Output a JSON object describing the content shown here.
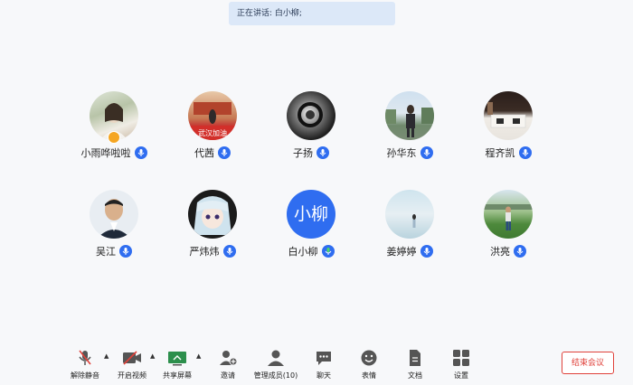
{
  "speaking_label": "正在讲话: 白小柳;",
  "participants": [
    {
      "name": "小雨哗啦啦",
      "kind": "photo",
      "host": true
    },
    {
      "name": "代茜",
      "kind": "photo",
      "host": false
    },
    {
      "name": "子扬",
      "kind": "photo",
      "host": false
    },
    {
      "name": "孙华东",
      "kind": "photo",
      "host": false
    },
    {
      "name": "程齐凯",
      "kind": "photo",
      "host": false
    },
    {
      "name": "吴江",
      "kind": "photo",
      "host": false
    },
    {
      "name": "严炜炜",
      "kind": "photo",
      "host": false
    },
    {
      "name": "白小柳",
      "kind": "text",
      "avatar_text": "小柳",
      "host": false,
      "speaking": true
    },
    {
      "name": "姜婷婷",
      "kind": "photo",
      "host": false
    },
    {
      "name": "洪亮",
      "kind": "photo",
      "host": false
    }
  ],
  "toolbar": {
    "unmute": "解除静音",
    "start_video": "开启视频",
    "share_screen": "共享屏幕",
    "invite": "邀请",
    "manage_members": "管理成员(10)",
    "chat": "聊天",
    "reactions": "表情",
    "documents": "文档",
    "settings": "设置"
  },
  "end_meeting": "结束会议",
  "colors": {
    "accent": "#2f6df0",
    "danger": "#e0413a",
    "banner": "#dce8f8"
  }
}
